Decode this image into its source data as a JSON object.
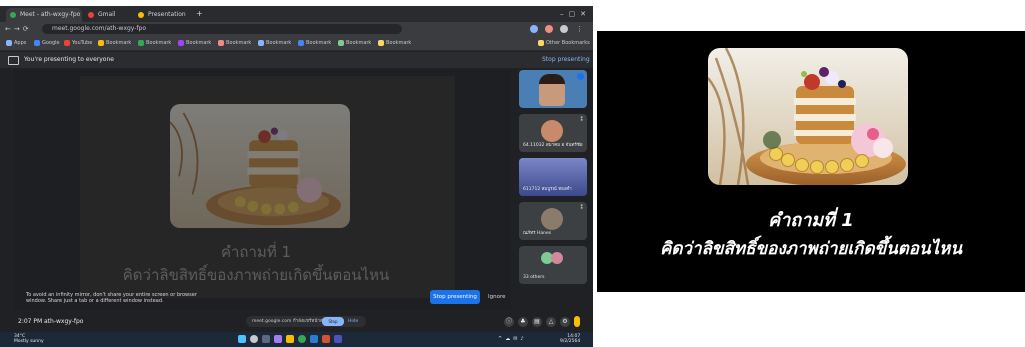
{
  "browser": {
    "tabs": [
      {
        "label": "Meet - ath-wxgy-fpo",
        "color": "#34a853"
      },
      {
        "label": "Gmail",
        "color": "#ea4335"
      },
      {
        "label": "Presentation",
        "color": "#fbbc04"
      }
    ],
    "url": "meet.google.com/ath-wxgy-fpo",
    "bookmarks": [
      {
        "label": "Apps",
        "color": "#8ab4f8"
      },
      {
        "label": "Google",
        "color": "#4285f4"
      },
      {
        "label": "YouTube",
        "color": "#ea4335"
      },
      {
        "label": "Bookmark",
        "color": "#fbbc04"
      },
      {
        "label": "Bookmark",
        "color": "#34a853"
      },
      {
        "label": "Bookmark",
        "color": "#a142f4"
      },
      {
        "label": "Bookmark",
        "color": "#f28b82"
      },
      {
        "label": "Bookmark",
        "color": "#8ab4f8"
      },
      {
        "label": "Bookmark",
        "color": "#4285f4"
      },
      {
        "label": "Bookmark",
        "color": "#81c995"
      },
      {
        "label": "Bookmark",
        "color": "#fdd663"
      },
      {
        "label": "Other Bookmarks",
        "color": "#fdd663"
      }
    ]
  },
  "meet": {
    "presenting_text": "You're presenting to everyone",
    "stop_presenting_top": "Stop presenting",
    "warning": "To avoid an infinity mirror, don't share your entire screen or browser window. Share just a tab or a different window instead.",
    "stop_presenting_button": "Stop presenting",
    "ignore": "Ignore",
    "participants": [
      {
        "label": ""
      },
      {
        "label": "64.11032 สมาคม อ จันทร์ชัย"
      },
      {
        "label": "611712 สมบูรณ์ ทองคำ"
      },
      {
        "label": "ณภัทร Hanes"
      },
      {
        "label": "33 others"
      }
    ],
    "time": "2:07 PM",
    "code": "ath-wxgy-fpo",
    "pill_text": "meet.google.com กำลังแชร์หน้าต่างของคุณ",
    "pill_button": "Stop sharing",
    "pill_hide": "Hide"
  },
  "taskbar": {
    "weather_temp": "34°C",
    "weather_desc": "Mostly sunny",
    "clock_time": "14:07",
    "clock_date": "9/2/2564"
  },
  "slide": {
    "question_title": "คำถามที่ 1",
    "question_text": "คิดว่าลิขสิทธิ์ของภาพถ่ายเกิดขึ้นตอนไหน"
  },
  "colors": {
    "meet_bg": "#202124",
    "accent_blue": "#1a73e8",
    "slide_bg": "#000000",
    "slide_text": "#ffffff"
  }
}
